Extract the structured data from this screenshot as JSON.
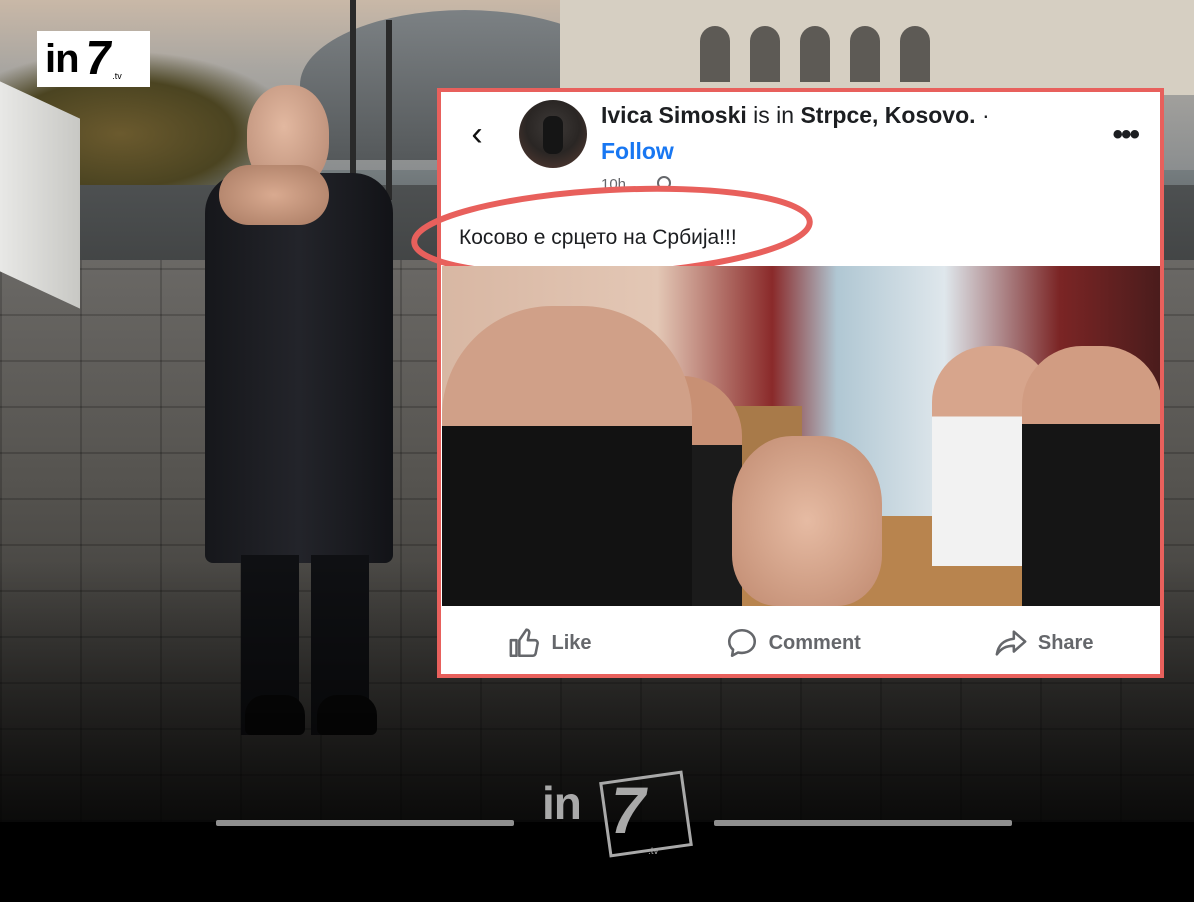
{
  "logo": {
    "in": "in",
    "seven": "7",
    "tv": ".tv"
  },
  "post": {
    "author": "Ivica Simoski",
    "location_prefix": "is in",
    "location": "Strpce, Kosovo.",
    "separator": "·",
    "follow_label": "Follow",
    "more_label": "•••",
    "back_label": "‹",
    "timestamp": "10h",
    "text": "Косово е срцето на Србија!!!",
    "highlight_color": "#e8605c",
    "actions": {
      "like": "Like",
      "comment": "Comment",
      "share": "Share"
    },
    "icons": {
      "back": "chevron-left-icon",
      "more": "more-options-icon",
      "globe": "globe-icon",
      "like": "thumbs-up-icon",
      "comment": "comment-bubble-icon",
      "share": "share-arrow-icon"
    }
  },
  "watermark": {
    "in": "in",
    "seven": "7",
    "tv": ".tv"
  },
  "colors": {
    "facebook_blue": "#1877f2",
    "card_border": "#e8605c",
    "text": "#1c1e21",
    "muted": "#65676b"
  }
}
